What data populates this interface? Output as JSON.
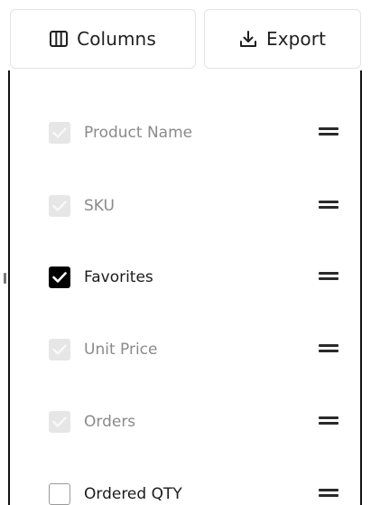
{
  "toolbar": {
    "columns_label": "Columns",
    "export_label": "Export"
  },
  "columns": [
    {
      "label": "Product Name",
      "state": "checked-disabled"
    },
    {
      "label": "SKU",
      "state": "checked-disabled"
    },
    {
      "label": "Favorites",
      "state": "checked"
    },
    {
      "label": "Unit Price",
      "state": "checked-disabled"
    },
    {
      "label": "Orders",
      "state": "checked-disabled"
    },
    {
      "label": "Ordered QTY",
      "state": "unchecked"
    }
  ]
}
